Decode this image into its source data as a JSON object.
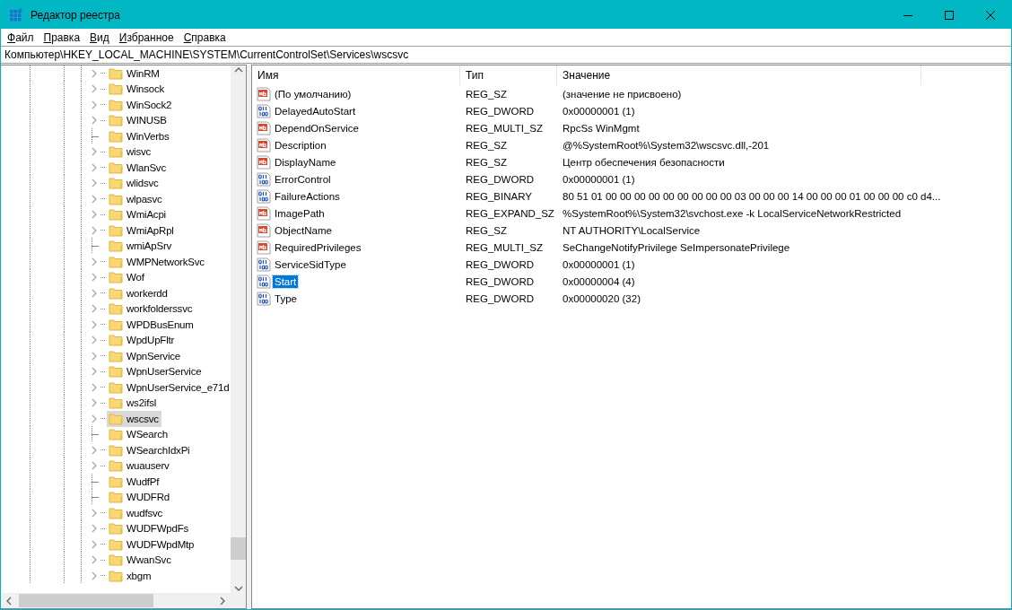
{
  "window": {
    "title": "Редактор реестра"
  },
  "menu": [
    "Файл",
    "Правка",
    "Вид",
    "Избранное",
    "Справка"
  ],
  "address": "Компьютер\\HKEY_LOCAL_MACHINE\\SYSTEM\\CurrentControlSet\\Services\\wscsvc",
  "tree": {
    "items": [
      {
        "label": "WinRM",
        "expandable": true,
        "selected": false
      },
      {
        "label": "Winsock",
        "expandable": true,
        "selected": false
      },
      {
        "label": "WinSock2",
        "expandable": true,
        "selected": false
      },
      {
        "label": "WINUSB",
        "expandable": true,
        "selected": false
      },
      {
        "label": "WinVerbs",
        "expandable": false,
        "selected": false
      },
      {
        "label": "wisvc",
        "expandable": true,
        "selected": false
      },
      {
        "label": "WlanSvc",
        "expandable": true,
        "selected": false
      },
      {
        "label": "wlidsvc",
        "expandable": true,
        "selected": false
      },
      {
        "label": "wlpasvc",
        "expandable": true,
        "selected": false
      },
      {
        "label": "WmiAcpi",
        "expandable": true,
        "selected": false
      },
      {
        "label": "WmiApRpl",
        "expandable": true,
        "selected": false
      },
      {
        "label": "wmiApSrv",
        "expandable": false,
        "selected": false
      },
      {
        "label": "WMPNetworkSvc",
        "expandable": true,
        "selected": false
      },
      {
        "label": "Wof",
        "expandable": true,
        "selected": false
      },
      {
        "label": "workerdd",
        "expandable": true,
        "selected": false
      },
      {
        "label": "workfolderssvc",
        "expandable": true,
        "selected": false
      },
      {
        "label": "WPDBusEnum",
        "expandable": true,
        "selected": false
      },
      {
        "label": "WpdUpFltr",
        "expandable": true,
        "selected": false
      },
      {
        "label": "WpnService",
        "expandable": true,
        "selected": false
      },
      {
        "label": "WpnUserService",
        "expandable": true,
        "selected": false
      },
      {
        "label": "WpnUserService_e71d",
        "expandable": true,
        "selected": false
      },
      {
        "label": "ws2ifsl",
        "expandable": true,
        "selected": false
      },
      {
        "label": "wscsvc",
        "expandable": true,
        "selected": true
      },
      {
        "label": "WSearch",
        "expandable": false,
        "selected": false
      },
      {
        "label": "WSearchIdxPi",
        "expandable": true,
        "selected": false
      },
      {
        "label": "wuauserv",
        "expandable": true,
        "selected": false
      },
      {
        "label": "WudfPf",
        "expandable": false,
        "selected": false
      },
      {
        "label": "WUDFRd",
        "expandable": false,
        "selected": false
      },
      {
        "label": "wudfsvc",
        "expandable": true,
        "selected": false
      },
      {
        "label": "WUDFWpdFs",
        "expandable": true,
        "selected": false
      },
      {
        "label": "WUDFWpdMtp",
        "expandable": true,
        "selected": false
      },
      {
        "label": "WwanSvc",
        "expandable": true,
        "selected": false
      },
      {
        "label": "xbgm",
        "expandable": true,
        "selected": false
      }
    ]
  },
  "values": {
    "columns": [
      "Имя",
      "Тип",
      "Значение"
    ],
    "rows": [
      {
        "name": "(По умолчанию)",
        "kind": "string",
        "type": "REG_SZ",
        "data": "(значение не присвоено)",
        "selected": false
      },
      {
        "name": "DelayedAutoStart",
        "kind": "binary",
        "type": "REG_DWORD",
        "data": "0x00000001 (1)",
        "selected": false
      },
      {
        "name": "DependOnService",
        "kind": "string",
        "type": "REG_MULTI_SZ",
        "data": "RpcSs WinMgmt",
        "selected": false
      },
      {
        "name": "Description",
        "kind": "string",
        "type": "REG_SZ",
        "data": "@%SystemRoot%\\System32\\wscsvc.dll,-201",
        "selected": false
      },
      {
        "name": "DisplayName",
        "kind": "string",
        "type": "REG_SZ",
        "data": "Центр обеспечения безопасности",
        "selected": false
      },
      {
        "name": "ErrorControl",
        "kind": "binary",
        "type": "REG_DWORD",
        "data": "0x00000001 (1)",
        "selected": false
      },
      {
        "name": "FailureActions",
        "kind": "binary",
        "type": "REG_BINARY",
        "data": "80 51 01 00 00 00 00 00 00 00 00 00 03 00 00 00 14 00 00 00 01 00 00 00 c0 d4...",
        "selected": false
      },
      {
        "name": "ImagePath",
        "kind": "string",
        "type": "REG_EXPAND_SZ",
        "data": "%SystemRoot%\\System32\\svchost.exe -k LocalServiceNetworkRestricted",
        "selected": false
      },
      {
        "name": "ObjectName",
        "kind": "string",
        "type": "REG_SZ",
        "data": "NT AUTHORITY\\LocalService",
        "selected": false
      },
      {
        "name": "RequiredPrivileges",
        "kind": "string",
        "type": "REG_MULTI_SZ",
        "data": "SeChangeNotifyPrivilege SeImpersonatePrivilege",
        "selected": false
      },
      {
        "name": "ServiceSidType",
        "kind": "binary",
        "type": "REG_DWORD",
        "data": "0x00000001 (1)",
        "selected": false
      },
      {
        "name": "Start",
        "kind": "binary",
        "type": "REG_DWORD",
        "data": "0x00000004 (4)",
        "selected": true
      },
      {
        "name": "Type",
        "kind": "binary",
        "type": "REG_DWORD",
        "data": "0x00000020 (32)",
        "selected": false
      }
    ]
  }
}
